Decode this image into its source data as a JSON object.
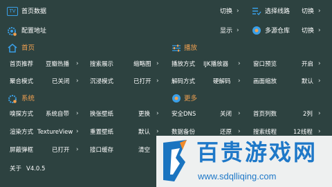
{
  "top": {
    "home_data": {
      "label": "首页数据",
      "value": "切换"
    },
    "select_route": {
      "label": "选择线路",
      "value": "切换"
    },
    "config_address": {
      "label": "配置地址",
      "value": "显示"
    },
    "multi_repo": {
      "label": "多源仓库",
      "value": "切换"
    }
  },
  "sections": {
    "home": {
      "title": "首页",
      "tv_badge": "TV"
    },
    "playback": {
      "title": "播放"
    },
    "system": {
      "title": "系统"
    },
    "more": {
      "title": "更多"
    }
  },
  "home_rows": [
    {
      "label": "首页推荐",
      "value": "豆瓣热播"
    },
    {
      "label": "搜索展示",
      "value": "缩略图"
    },
    {
      "label": "聚合模式",
      "value": "已关闭"
    },
    {
      "label": "沉浸模式",
      "value": "已打开"
    }
  ],
  "play_rows": [
    {
      "label": "播放方式",
      "value": "IJK播放器"
    },
    {
      "label": "窗口预览",
      "value": "开启"
    },
    {
      "label": "解码方式",
      "value": "硬解码"
    },
    {
      "label": "画面缩放",
      "value": "默认"
    }
  ],
  "system_rows": [
    {
      "label": "嗅探方式",
      "value": "系统自带"
    },
    {
      "label": "换张壁纸",
      "value": "更换"
    },
    {
      "label": "渲染方式",
      "value": "TextureView"
    },
    {
      "label": "重置壁纸",
      "value": "默认"
    },
    {
      "label": "屏蔽弹框",
      "value": "已打开"
    },
    {
      "label": "接口缓存",
      "value": "清空"
    }
  ],
  "more_rows": [
    {
      "label": "安全DNS",
      "value": "关闭"
    },
    {
      "label": "首页列数",
      "value": "2列"
    },
    {
      "label": "数据备份",
      "value": "还原"
    },
    {
      "label": "搜索线程",
      "value": "12线程"
    }
  ],
  "about": {
    "label": "关于",
    "version": "V4.0.5"
  },
  "watermark": {
    "brand": "百贵游戏网",
    "url": "www.sdqlliqing.com"
  },
  "colors": {
    "background": "#2d4240",
    "section_header": "#f0a050",
    "icon_blue": "#3aa0e8"
  }
}
